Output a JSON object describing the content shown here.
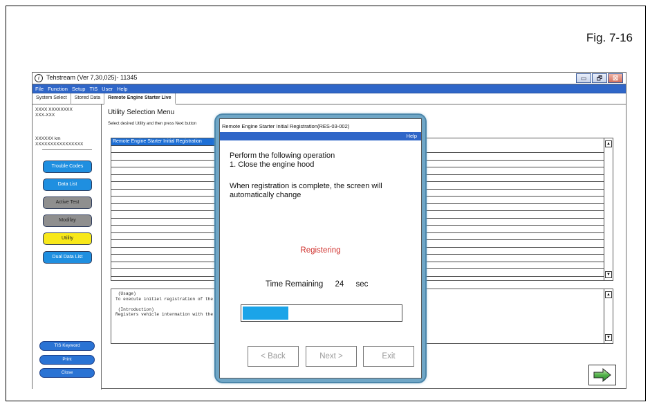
{
  "figure_label": "Fig. 7-16",
  "window": {
    "title": "Tehstream (Ver 7,30,025)- 11345",
    "controls": {
      "minimize": "▭",
      "restore": "🗗",
      "close": "☒"
    }
  },
  "menubar": [
    "File",
    "Function",
    "Setup",
    "TIS",
    "User",
    "Help"
  ],
  "tabs": [
    "System Select",
    "Stored Data",
    "Remote Engine Starter Live"
  ],
  "sidebar": {
    "vehicle_line1": "XXXX XXXXXXXX",
    "vehicle_line2": "XXX-XXX",
    "km_line": "XXXXXX km",
    "code_line": "XXXXXXXXXXXXXXXX",
    "buttons": [
      {
        "label": "Trouble Codes",
        "style": "blue"
      },
      {
        "label": "Data List",
        "style": "blue"
      },
      {
        "label": "Active Test",
        "style": "gray"
      },
      {
        "label": "Modifay",
        "style": "gray"
      },
      {
        "label": "Utility",
        "style": "yellow"
      },
      {
        "label": "Dual Data List",
        "style": "blue"
      }
    ],
    "bottom_buttons": [
      "TIS Keyword",
      "Print",
      "Close"
    ]
  },
  "main": {
    "title": "Utility Selection Menu",
    "subtitle": "Select desired Utility and then press Next  button",
    "list_items": [
      "Remote Engine Starter Initial Registration"
    ],
    "info_text": " (Usage)\nTo execute initiel registration of the\n\n (Introduction)\nRegisters vehicle intermation with the"
  },
  "dialog": {
    "title": "Remote Engine Starter Initial Registration(RES-03-002)",
    "help": "Help",
    "instruction_line1": "Perform the following operation",
    "instruction_line2": "1. Close the engine hood",
    "completion_note": "When registration is complete, the screen will automatically change",
    "status": "Registering",
    "time_label": "Time Remaining",
    "time_value": "24",
    "time_unit": "sec",
    "progress_fraction": 0.29,
    "buttons": {
      "back": "< Back",
      "next": "Next >",
      "exit": "Exit"
    }
  },
  "colors": {
    "accent_blue": "#2f66c8",
    "progress_blue": "#1ba4e8",
    "status_red": "#d0312d",
    "utility_yellow": "#f8e81a"
  }
}
